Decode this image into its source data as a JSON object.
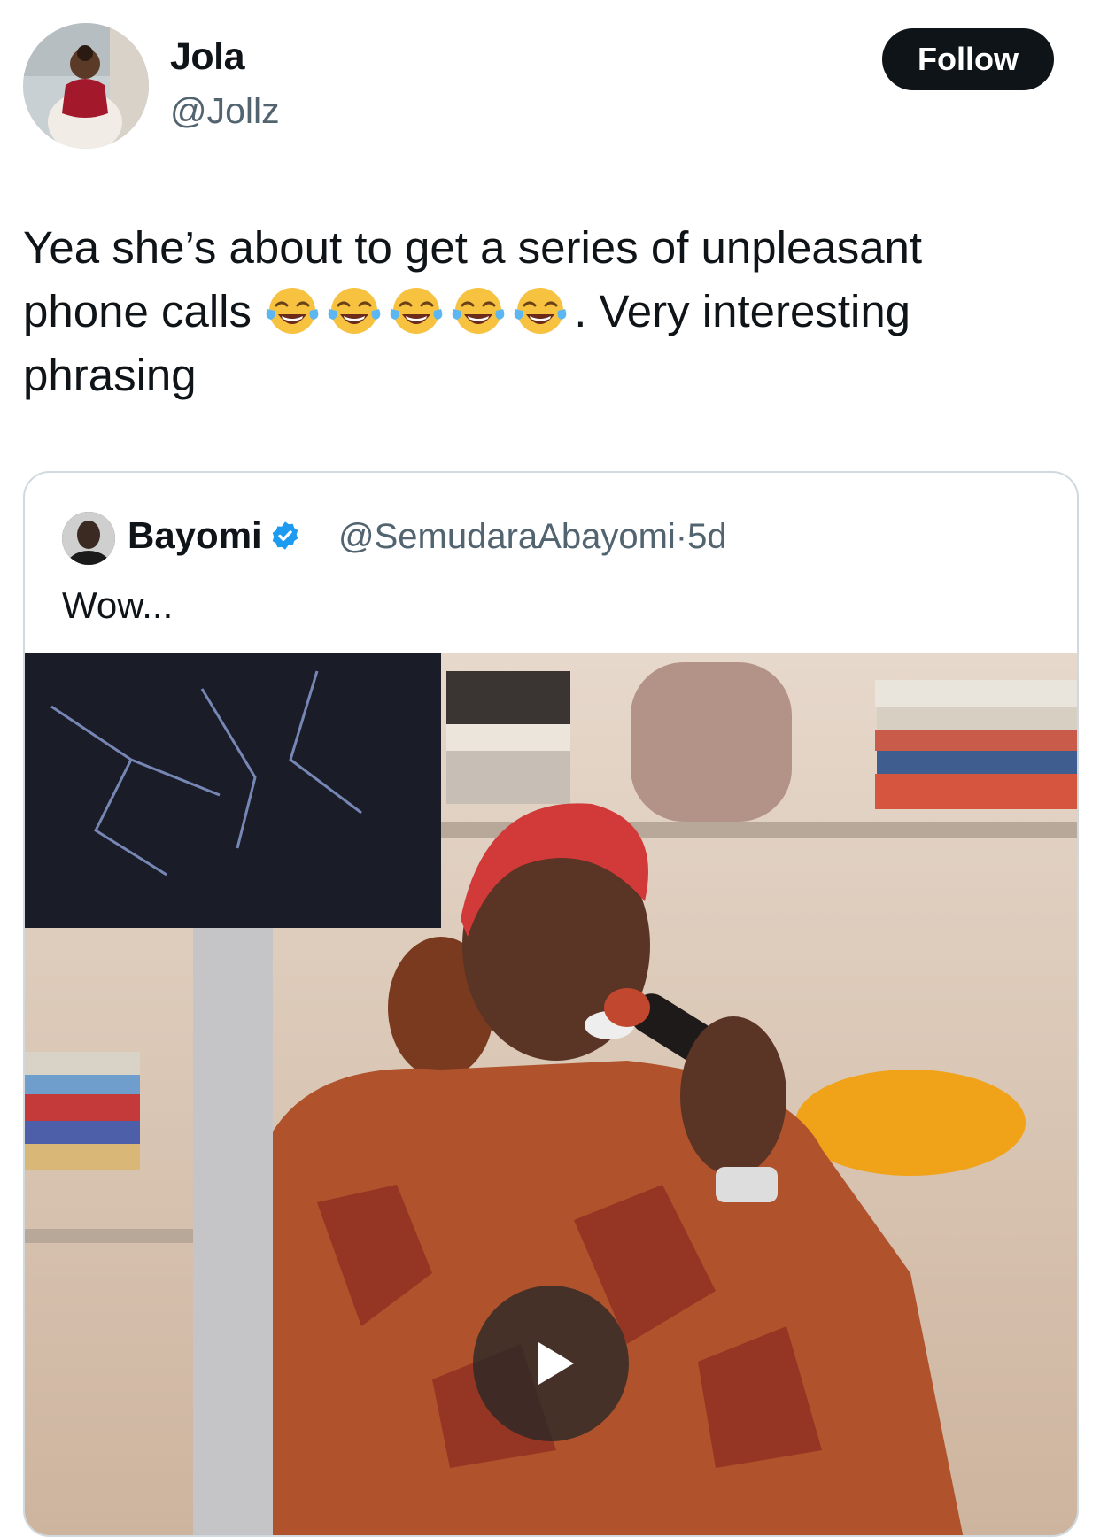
{
  "author": {
    "display_name": "Jola",
    "handle": "@Jollz",
    "avatar_icon": "profile-photo-child"
  },
  "follow_button": {
    "label": "Follow"
  },
  "tweet": {
    "line1": "Yea she’s about to get a series of unpleasant",
    "line2_before": "phone calls ",
    "emoji_icon": "face-with-tears-of-joy-emoji",
    "emoji_count": 5,
    "line2_after": ". Very interesting",
    "line3": "phrasing"
  },
  "quoted_tweet": {
    "display_name": "Bayomi",
    "verified_icon": "verified-badge-icon",
    "verified_color": "#1d9bf0",
    "handle": "@SemudaraAbayomi",
    "separator": "·",
    "time": "5d",
    "text": "Wow...",
    "media": {
      "type": "video",
      "play_icon": "play-icon"
    }
  },
  "colors": {
    "text_primary": "#0f1419",
    "text_secondary": "#536471",
    "border": "#cfd9de",
    "button_bg": "#0f1419"
  }
}
